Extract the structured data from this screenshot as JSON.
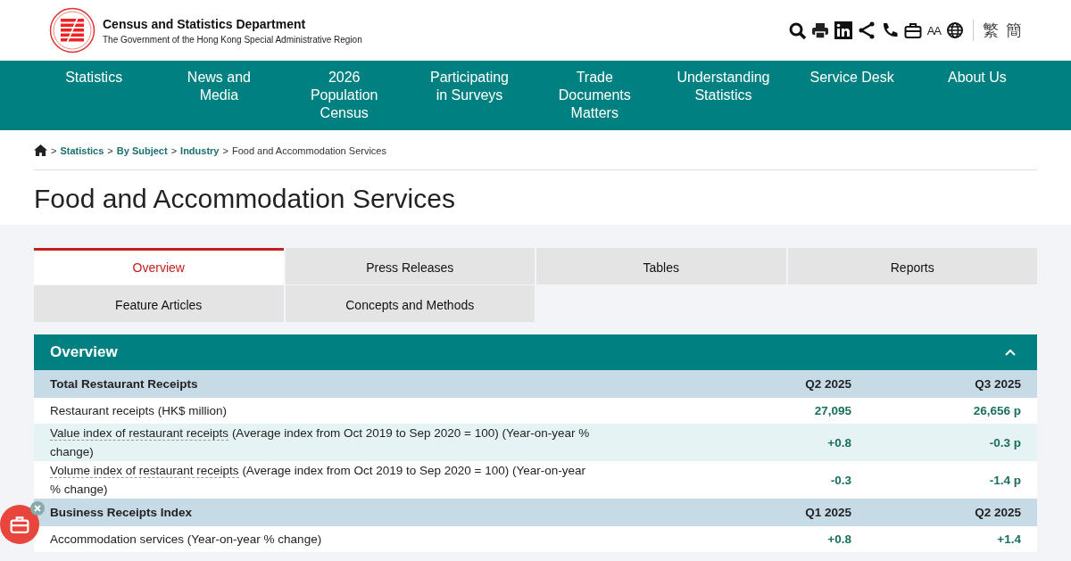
{
  "header": {
    "department": "Census and Statistics Department",
    "government": "The Government of the Hong Kong Special Administrative Region",
    "tools": [
      {
        "kind": "search"
      },
      {
        "kind": "print"
      },
      {
        "kind": "linkedin"
      },
      {
        "kind": "share"
      },
      {
        "kind": "phone"
      },
      {
        "kind": "briefcase"
      },
      {
        "kind": "fontsize",
        "label": "AA"
      },
      {
        "kind": "globe"
      }
    ],
    "languages": [
      "繁",
      "簡"
    ]
  },
  "nav": [
    "Statistics",
    "News and Media",
    "2026 Population Census",
    "Participating in Surveys",
    "Trade Documents Matters",
    "Understanding Statistics",
    "Service Desk",
    "About Us"
  ],
  "breadcrumb": [
    {
      "separator": ">",
      "label": "Statistics",
      "link": true
    },
    {
      "separator": ">",
      "label": "By Subject",
      "link": true
    },
    {
      "separator": ">",
      "label": "Industry",
      "link": true
    },
    {
      "separator": ">",
      "label": "Food and Accommodation Services",
      "link": false
    }
  ],
  "page_title": "Food and Accommodation Services",
  "tabs": [
    {
      "label": "Overview",
      "selected": true
    },
    {
      "label": "Press Releases",
      "selected": false
    },
    {
      "label": "Tables",
      "selected": false
    },
    {
      "label": "Reports",
      "selected": false
    },
    {
      "label": "Feature Articles",
      "selected": false
    },
    {
      "label": "Concepts and Methods",
      "selected": false
    }
  ],
  "panel": {
    "title": "Overview",
    "expanded": true,
    "rows": [
      {
        "kind": "group",
        "label": "Total Restaurant Receipts",
        "col1": "Q2 2025",
        "col2": "Q3 2025"
      },
      {
        "kind": "data",
        "label": "Restaurant receipts (HK$ million)",
        "col1": "27,095",
        "col2": "26,656 p"
      },
      {
        "kind": "data",
        "term": "Value index of restaurant receipts",
        "label": " (Average index from Oct 2019 to Sep 2020 = 100) (Year-on-year % change)",
        "col1": "+0.8",
        "col2": "-0.3 p"
      },
      {
        "kind": "data",
        "term": "Volume index of restaurant receipts",
        "label": " (Average index from Oct 2019 to Sep 2020 = 100) (Year-on-year % change)",
        "col1": "-0.3",
        "col2": "-1.4 p"
      },
      {
        "kind": "group",
        "label": "Business Receipts Index",
        "col1": "Q1 2025",
        "col2": "Q2 2025"
      },
      {
        "kind": "data",
        "label": "Accommodation services (Year-on-year % change)",
        "col1": "+0.8",
        "col2": "+1.4"
      }
    ]
  }
}
